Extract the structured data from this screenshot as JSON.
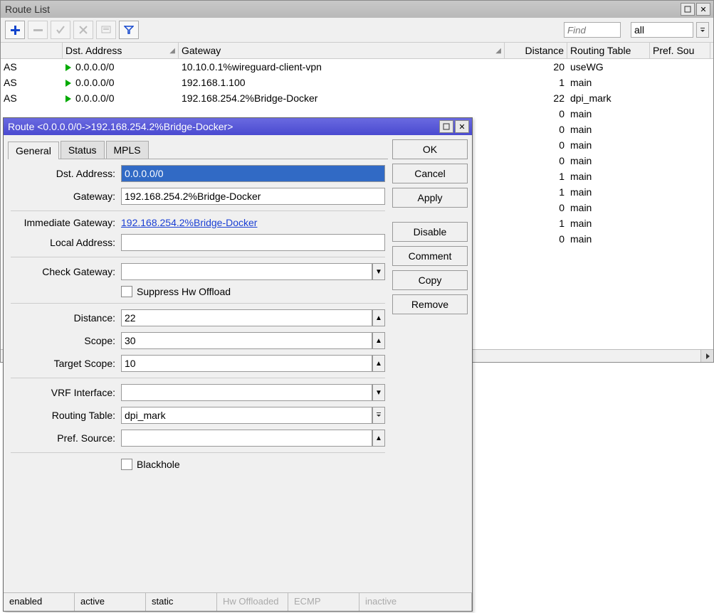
{
  "main_window": {
    "title": "Route List"
  },
  "toolbar": {
    "find_placeholder": "Find",
    "filter_value": "all"
  },
  "columns": {
    "flag": "",
    "dst": "Dst. Address",
    "gw": "Gateway",
    "dist": "Distance",
    "rt": "Routing Table",
    "ps": "Pref. Sou"
  },
  "rows": [
    {
      "flag": "AS",
      "dst": "0.0.0.0/0",
      "gw": "10.10.0.1%wireguard-client-vpn",
      "dist": "20",
      "rt": "useWG"
    },
    {
      "flag": "AS",
      "dst": "0.0.0.0/0",
      "gw": "192.168.1.100",
      "dist": "1",
      "rt": "main"
    },
    {
      "flag": "AS",
      "dst": "0.0.0.0/0",
      "gw": "192.168.254.2%Bridge-Docker",
      "dist": "22",
      "rt": "dpi_mark"
    },
    {
      "flag": "",
      "dst": "",
      "gw": "",
      "dist": "0",
      "rt": "main"
    },
    {
      "flag": "",
      "dst": "",
      "gw": "",
      "dist": "0",
      "rt": "main"
    },
    {
      "flag": "",
      "dst": "",
      "gw": "",
      "dist": "0",
      "rt": "main"
    },
    {
      "flag": "",
      "dst": "",
      "gw": "",
      "dist": "0",
      "rt": "main"
    },
    {
      "flag": "",
      "dst": "",
      "gw": "",
      "dist": "1",
      "rt": "main"
    },
    {
      "flag": "",
      "dst": "",
      "gw": "",
      "dist": "1",
      "rt": "main"
    },
    {
      "flag": "",
      "dst": "",
      "gw": "",
      "dist": "0",
      "rt": "main"
    },
    {
      "flag": "",
      "dst": "",
      "gw": "",
      "dist": "1",
      "rt": "main"
    },
    {
      "flag": "",
      "dst": "",
      "gw": "",
      "dist": "0",
      "rt": "main"
    }
  ],
  "dialog": {
    "title": "Route <0.0.0.0/0->192.168.254.2%Bridge-Docker>",
    "tabs": {
      "general": "General",
      "status": "Status",
      "mpls": "MPLS"
    },
    "labels": {
      "dst": "Dst. Address:",
      "gw": "Gateway:",
      "igw": "Immediate Gateway:",
      "laddr": "Local Address:",
      "checkgw": "Check Gateway:",
      "suppress": "Suppress Hw Offload",
      "distance": "Distance:",
      "scope": "Scope:",
      "ts": "Target Scope:",
      "vrf": "VRF Interface:",
      "rt": "Routing Table:",
      "ps": "Pref. Source:",
      "blackhole": "Blackhole"
    },
    "values": {
      "dst": "0.0.0.0/0",
      "gw": "192.168.254.2%Bridge-Docker",
      "igw": "192.168.254.2%Bridge-Docker",
      "laddr": "",
      "checkgw": "",
      "distance": "22",
      "scope": "30",
      "ts": "10",
      "vrf": "",
      "rt": "dpi_mark",
      "ps": ""
    },
    "buttons": {
      "ok": "OK",
      "cancel": "Cancel",
      "apply": "Apply",
      "disable": "Disable",
      "comment": "Comment",
      "copy": "Copy",
      "remove": "Remove"
    },
    "status": [
      "enabled",
      "active",
      "static",
      "Hw Offloaded",
      "ECMP",
      "inactive"
    ]
  }
}
